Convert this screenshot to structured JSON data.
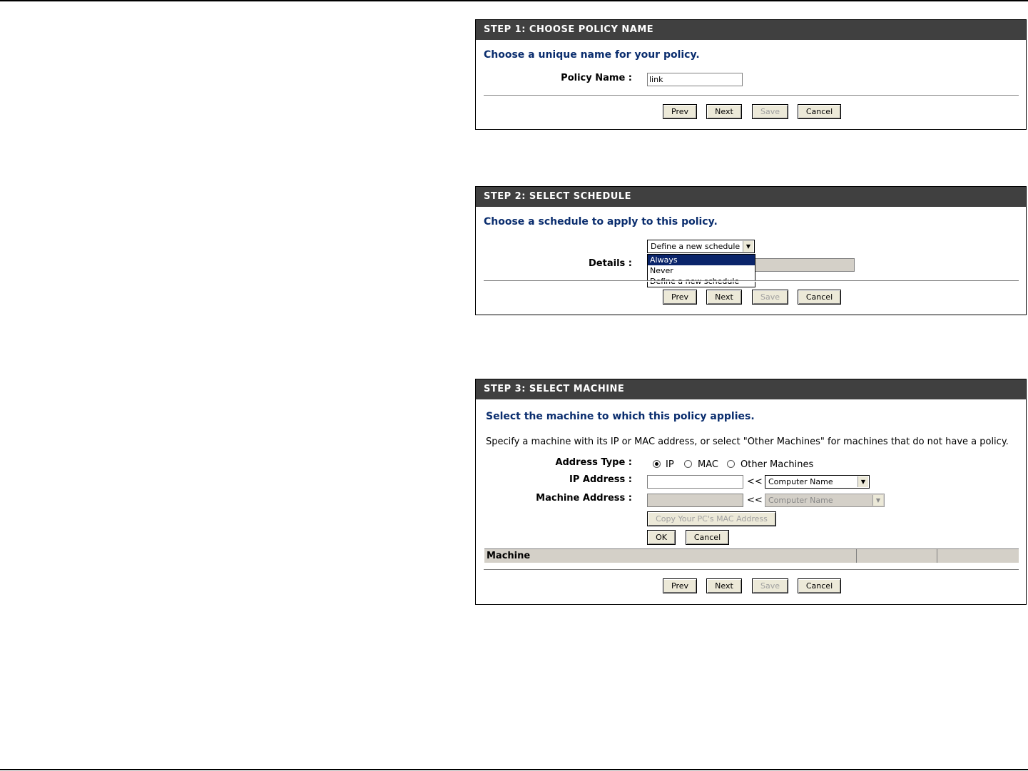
{
  "buttons": {
    "prev": "Prev",
    "next": "Next",
    "save": "Save",
    "cancel": "Cancel"
  },
  "step1": {
    "header": "STEP 1: CHOOSE POLICY NAME",
    "heading": "Choose a unique name for your policy.",
    "policy_name_label": "Policy Name :",
    "policy_name_value": "link"
  },
  "step2": {
    "header": "STEP 2: SELECT SCHEDULE",
    "heading": "Choose a schedule to apply to this policy.",
    "schedule_selected": "Define a new schedule",
    "schedule_options": [
      "Always",
      "Never",
      "Define a new schedule"
    ],
    "highlighted_option": "Always",
    "details_label": "Details :",
    "details_value": ""
  },
  "step3": {
    "header": "STEP 3: SELECT MACHINE",
    "heading": "Select the machine to which this policy applies.",
    "description": "Specify a machine with its IP or MAC address, or select \"Other Machines\" for machines that do not have a policy.",
    "address_type_label": "Address Type :",
    "address_types": [
      {
        "label": "IP",
        "checked": true
      },
      {
        "label": "MAC",
        "checked": false
      },
      {
        "label": "Other Machines",
        "checked": false
      }
    ],
    "ip_address_label": "IP Address :",
    "ip_address_value": "",
    "machine_address_label": "Machine Address :",
    "machine_address_value": "",
    "arrow_text": "<<",
    "computer_name_select": "Computer Name",
    "copy_mac_button": "Copy Your PC's MAC Address",
    "ok_button": "OK",
    "cancel_button": "Cancel",
    "table_header": "Machine"
  }
}
